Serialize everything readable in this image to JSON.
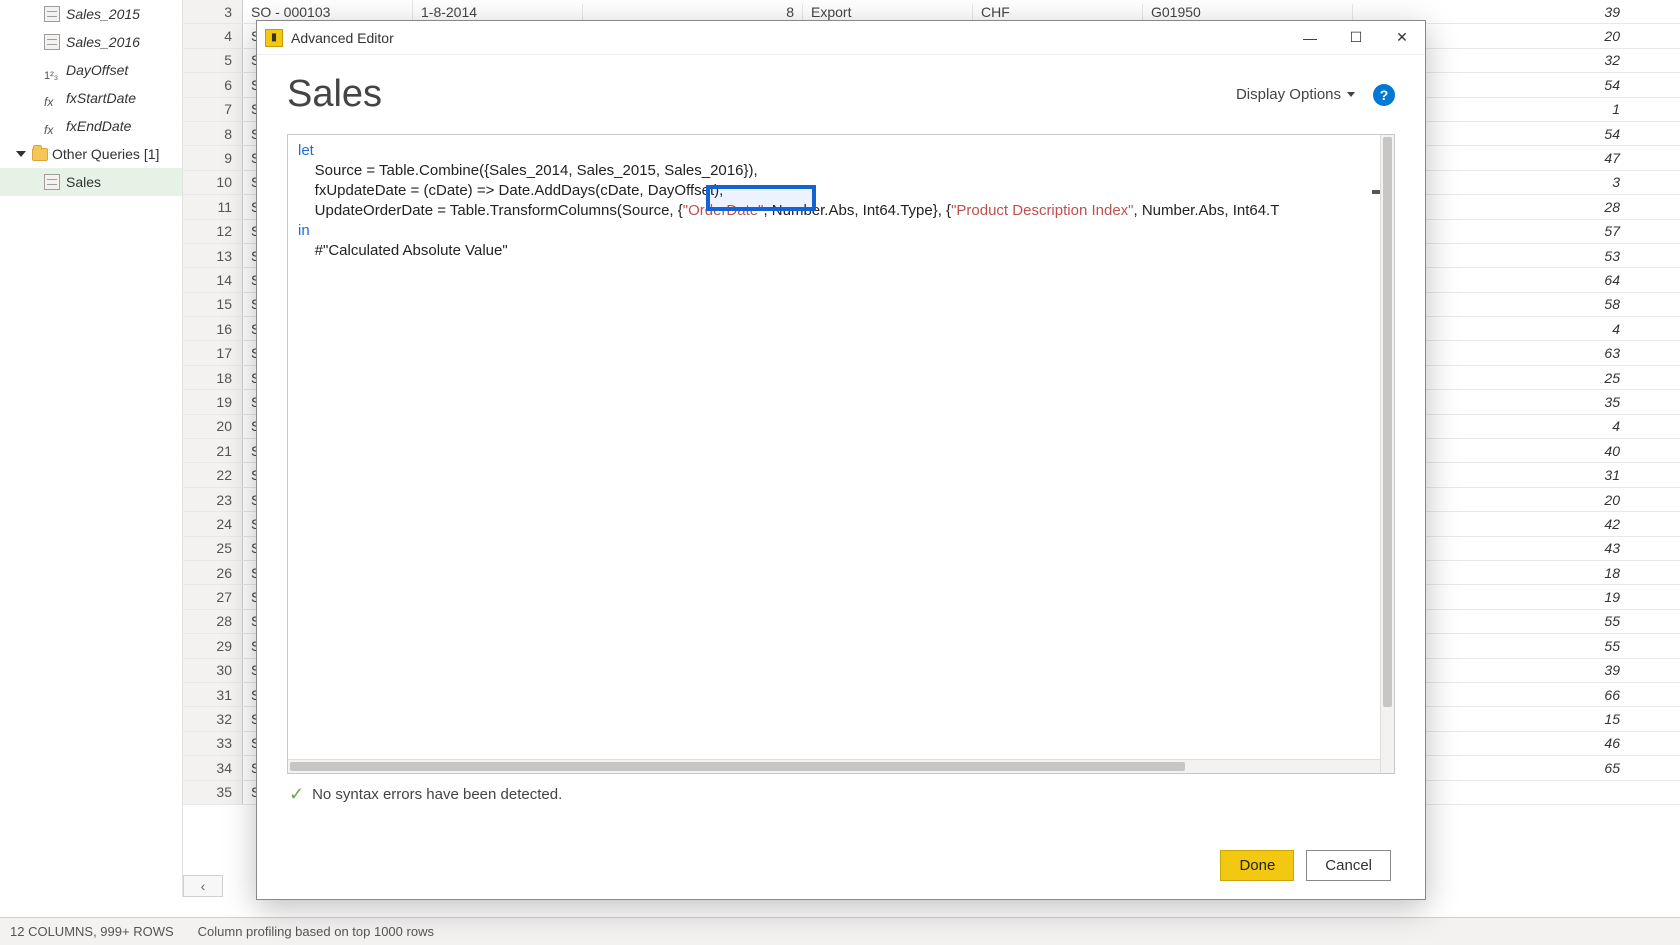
{
  "queries_pane": {
    "items": [
      {
        "type": "table",
        "label": "Sales_2015",
        "italic": true
      },
      {
        "type": "table",
        "label": "Sales_2016",
        "italic": true
      },
      {
        "type": "num",
        "label": "DayOffset",
        "italic": true
      },
      {
        "type": "fx",
        "label": "fxStartDate",
        "italic": true
      },
      {
        "type": "fx",
        "label": "fxEndDate",
        "italic": true
      }
    ],
    "group": {
      "label": "Other Queries [1]"
    },
    "selected": {
      "label": "Sales"
    }
  },
  "grid": {
    "first_row": {
      "num": "3",
      "so": "SO - 000103",
      "date": "1-8-2014",
      "qty": "8",
      "channel": "Export",
      "cur": "CHF",
      "code": "G01950",
      "last": "39"
    },
    "rows": [
      {
        "num": "4",
        "last": "20"
      },
      {
        "num": "5",
        "last": "32"
      },
      {
        "num": "6",
        "last": "54"
      },
      {
        "num": "7",
        "last": "1"
      },
      {
        "num": "8",
        "last": "54"
      },
      {
        "num": "9",
        "last": "47"
      },
      {
        "num": "10",
        "last": "3"
      },
      {
        "num": "11",
        "last": "28"
      },
      {
        "num": "12",
        "last": "57"
      },
      {
        "num": "13",
        "last": "53"
      },
      {
        "num": "14",
        "last": "64"
      },
      {
        "num": "15",
        "last": "58"
      },
      {
        "num": "16",
        "last": "4"
      },
      {
        "num": "17",
        "last": "63"
      },
      {
        "num": "18",
        "last": "25"
      },
      {
        "num": "19",
        "last": "35"
      },
      {
        "num": "20",
        "last": "4"
      },
      {
        "num": "21",
        "last": "40"
      },
      {
        "num": "22",
        "last": "31"
      },
      {
        "num": "23",
        "last": "20"
      },
      {
        "num": "24",
        "last": "42"
      },
      {
        "num": "25",
        "last": "43"
      },
      {
        "num": "26",
        "last": "18"
      },
      {
        "num": "27",
        "last": "19"
      },
      {
        "num": "28",
        "last": "55"
      },
      {
        "num": "29",
        "last": "55"
      },
      {
        "num": "30",
        "last": "39"
      },
      {
        "num": "31",
        "last": "66"
      },
      {
        "num": "32",
        "last": "15"
      },
      {
        "num": "33",
        "last": "46"
      },
      {
        "num": "34",
        "last": "65"
      },
      {
        "num": "35",
        "last": ""
      }
    ],
    "so_prefix": "SO -"
  },
  "status_bar": {
    "cols": "12 COLUMNS, 999+ ROWS",
    "profiling": "Column profiling based on top 1000 rows"
  },
  "modal": {
    "title": "Advanced Editor",
    "heading": "Sales",
    "display_options": "Display Options",
    "syntax_ok": "No syntax errors have been detected.",
    "done": "Done",
    "cancel": "Cancel",
    "code": {
      "let": "let",
      "l1a": "    Source = Table.Combine({Sales_2014, Sales_2015, Sales_2016}),",
      "l2a": "    fxUpdateDate = (cDate) => Date.AddDays(cDate, DayOffset),",
      "l3a": "    UpdateOrderDate = Table.TransformColumns(Source, {",
      "l3s1": "\"OrderDate\"",
      "l3b": ", Number.Abs, Int64.Type}, {",
      "l3s2": "\"Product Description Index\"",
      "l3c": ", Number.Abs, Int64.T",
      "in": "in",
      "l5": "    #\"Calculated Absolute Value\""
    }
  }
}
